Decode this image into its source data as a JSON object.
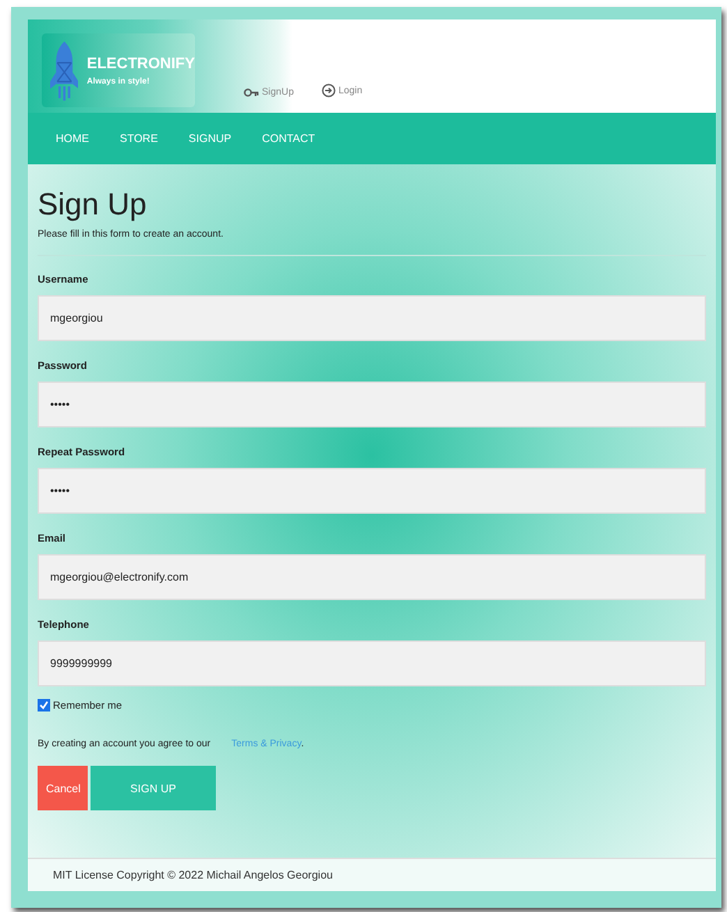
{
  "header": {
    "logo": {
      "title": "ELECTRONIFY",
      "tagline": "Always in style!"
    },
    "links": [
      {
        "label": "SignUp",
        "kind": "signup"
      },
      {
        "label": "Login",
        "kind": "login"
      }
    ]
  },
  "nav": [
    {
      "label": "HOME"
    },
    {
      "label": "STORE"
    },
    {
      "label": "SIGNUP"
    },
    {
      "label": "CONTACT"
    }
  ],
  "form": {
    "title": "Sign Up",
    "subtitle": "Please fill in this form to create an account.",
    "fields": [
      {
        "label": "Username",
        "value": "mgeorgiou"
      },
      {
        "label": "Password",
        "value": "•••••"
      },
      {
        "label": "Repeat Password",
        "value": "•••••"
      },
      {
        "label": "Email",
        "value": "mgeorgiou@electronify.com"
      },
      {
        "label": "Telephone",
        "value": "9999999999"
      }
    ],
    "remember": {
      "label": "Remember me",
      "checked": true
    },
    "terms": {
      "text": "By creating an account you agree to our",
      "link": "Terms & Privacy",
      "after": "."
    },
    "buttons": [
      {
        "label": "Cancel",
        "kind": "cancel"
      },
      {
        "label": "SIGN UP",
        "kind": "submit"
      }
    ]
  },
  "footer": "MIT License Copyright © 2022 Michail Angelos Georgiou"
}
